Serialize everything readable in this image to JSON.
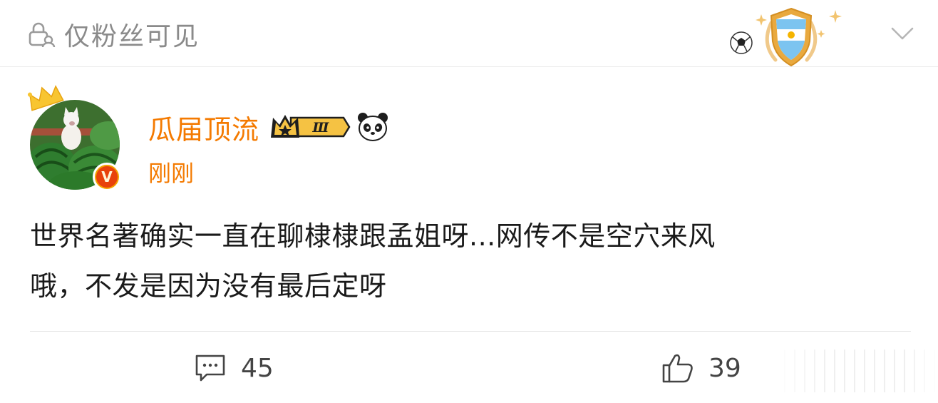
{
  "header": {
    "visibility_text": "仅粉丝可见",
    "lock_icon": "lock-person-icon",
    "badge_icon": "argentina-shield-football-badge",
    "chevron_icon": "chevron-down-icon"
  },
  "post": {
    "author": {
      "name": "瓜届顶流",
      "level_label": "Ⅲ",
      "verified_label": "V",
      "avatar": "white-cat-watermelon-avatar",
      "crown_icon": "crown-icon",
      "panda_icon": "panda-icon"
    },
    "timestamp": "刚刚",
    "content_line1": "世界名著确实一直在聊棣棣跟孟姐呀...网传不是空穴来风",
    "content_line2": "哦，不发是因为没有最后定呀"
  },
  "actions": {
    "comment_count": "45",
    "like_count": "39",
    "comment_icon": "comment-bubble-icon",
    "like_icon": "thumbs-up-icon"
  },
  "colors": {
    "accent": "#f47a00",
    "text": "#1a1a1a",
    "muted": "#8a8a8a"
  }
}
